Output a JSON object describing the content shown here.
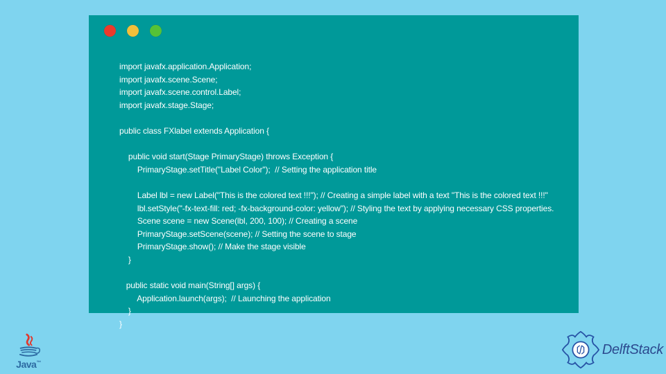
{
  "window": {
    "dots": {
      "red": "#ed3a2b",
      "yellow": "#f3bf3a",
      "green": "#56c237"
    }
  },
  "code": {
    "l1": "import javafx.application.Application;",
    "l2": "import javafx.scene.Scene;",
    "l3": "import javafx.scene.control.Label;",
    "l4": "import javafx.stage.Stage;",
    "l5": "",
    "l6": "public class FXlabel extends Application {",
    "l7": "",
    "l8": "    public void start(Stage PrimaryStage) throws Exception {",
    "l9": "        PrimaryStage.setTitle(\"Label Color\");  // Setting the application title",
    "l10": "",
    "l11": "        Label lbl = new Label(\"This is the colored text !!!\"); // Creating a simple label with a text \"This is the colored text !!!\"",
    "l12": "        lbl.setStyle(\"-fx-text-fill: red; -fx-background-color: yellow\"); // Styling the text by applying necessary CSS properties.",
    "l13": "        Scene scene = new Scene(lbl, 200, 100); // Creating a scene",
    "l14": "        PrimaryStage.setScene(scene); // Setting the scene to stage",
    "l15": "        PrimaryStage.show(); // Make the stage visible",
    "l16": "    }",
    "l17": "",
    "l18": "   public static void main(String[] args) {",
    "l19": "        Application.launch(args);  // Launching the application",
    "l20": "    }",
    "l21": "}"
  },
  "logos": {
    "java": {
      "label": "Java",
      "tm": "™"
    },
    "brand": {
      "label": "DelftStack"
    }
  }
}
